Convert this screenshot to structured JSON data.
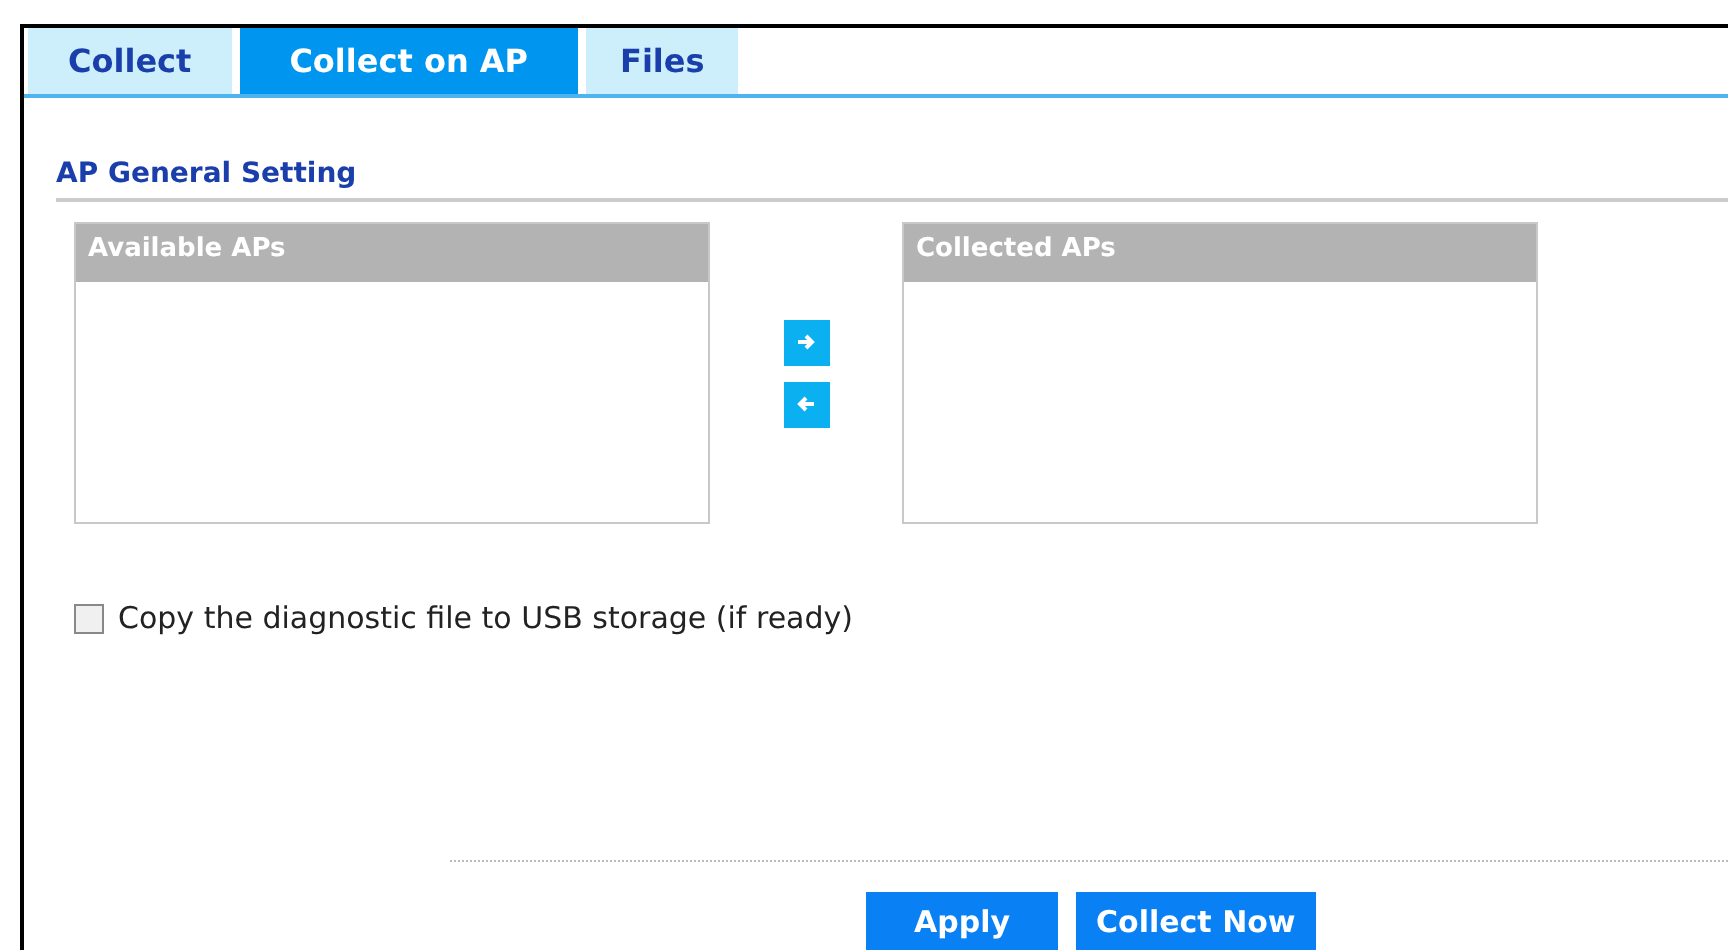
{
  "tabs": [
    {
      "label": "Collect",
      "selected": false
    },
    {
      "label": "Collect on AP",
      "selected": true
    },
    {
      "label": "Files",
      "selected": false
    }
  ],
  "section": {
    "title": "AP General Setting"
  },
  "lists": [
    {
      "header": "Available APs"
    },
    {
      "header": "Collected APs"
    }
  ],
  "move_buttons": [
    {
      "kind": "right"
    },
    {
      "kind": "left"
    }
  ],
  "copy_option": {
    "label": "Copy the diagnostic file to USB storage (if ready)",
    "checked": false
  },
  "buttons": [
    "Apply",
    "Collect Now"
  ]
}
